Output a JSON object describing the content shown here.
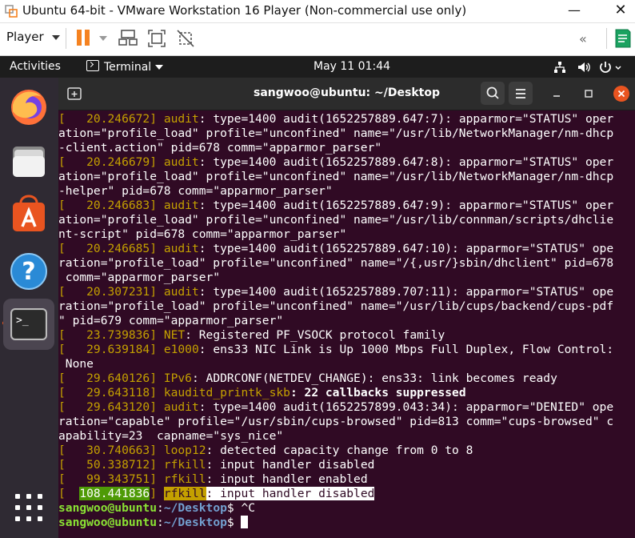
{
  "vmware": {
    "title": "Ubuntu 64-bit - VMware Workstation 16 Player (Non-commercial use only)",
    "player_menu": "Player",
    "minimize_symbol": "—",
    "close_symbol": "✕",
    "collapse_symbol": "«",
    "brand_color": "#f58220"
  },
  "ubuntu_topbar": {
    "activities": "Activities",
    "app_menu": "Terminal",
    "clock": "May 11  01:44"
  },
  "dock": {
    "items": [
      {
        "name": "Firefox",
        "icon": "firefox-icon"
      },
      {
        "name": "Files",
        "icon": "files-icon"
      },
      {
        "name": "Ubuntu Software",
        "icon": "software-store-icon"
      },
      {
        "name": "Help",
        "icon": "help-icon"
      },
      {
        "name": "Terminal",
        "icon": "terminal-icon",
        "active": true
      }
    ],
    "show_apps_icon": "apps-grid-icon"
  },
  "terminal": {
    "title": "sangwoo@ubuntu: ~/Desktop",
    "colors": {
      "background": "#300a24",
      "timestamp": "#c4a000",
      "user": "#8ae234",
      "path": "#729fcf",
      "close": "#e95420"
    },
    "lines": [
      {
        "pre": "[  ",
        "ts": " 20.246672",
        "post": "] ",
        "tag": "audit",
        "msg": ": type=1400 audit(1652257889.647:7): apparmor=\"STATUS\" oper"
      },
      {
        "plain": "ation=\"profile_load\" profile=\"unconfined\" name=\"/usr/lib/NetworkManager/nm-dhcp"
      },
      {
        "plain": "-client.action\" pid=678 comm=\"apparmor_parser\""
      },
      {
        "pre": "[  ",
        "ts": " 20.246679",
        "post": "] ",
        "tag": "audit",
        "msg": ": type=1400 audit(1652257889.647:8): apparmor=\"STATUS\" oper"
      },
      {
        "plain": "ation=\"profile_load\" profile=\"unconfined\" name=\"/usr/lib/NetworkManager/nm-dhcp"
      },
      {
        "plain": "-helper\" pid=678 comm=\"apparmor_parser\""
      },
      {
        "pre": "[  ",
        "ts": " 20.246683",
        "post": "] ",
        "tag": "audit",
        "msg": ": type=1400 audit(1652257889.647:9): apparmor=\"STATUS\" oper"
      },
      {
        "plain": "ation=\"profile_load\" profile=\"unconfined\" name=\"/usr/lib/connman/scripts/dhclie"
      },
      {
        "plain": "nt-script\" pid=678 comm=\"apparmor_parser\""
      },
      {
        "pre": "[  ",
        "ts": " 20.246685",
        "post": "] ",
        "tag": "audit",
        "msg": ": type=1400 audit(1652257889.647:10): apparmor=\"STATUS\" ope"
      },
      {
        "plain": "ration=\"profile_load\" profile=\"unconfined\" name=\"/{,usr/}sbin/dhclient\" pid=678"
      },
      {
        "plain": " comm=\"apparmor_parser\""
      },
      {
        "pre": "[  ",
        "ts": " 20.307231",
        "post": "] ",
        "tag": "audit",
        "msg": ": type=1400 audit(1652257889.707:11): apparmor=\"STATUS\" ope"
      },
      {
        "plain": "ration=\"profile_load\" profile=\"unconfined\" name=\"/usr/lib/cups/backend/cups-pdf"
      },
      {
        "plain": "\" pid=679 comm=\"apparmor_parser\""
      },
      {
        "pre": "[  ",
        "ts": " 23.739836",
        "post": "] ",
        "tag": "NET",
        "msg": ": Registered PF_VSOCK protocol family"
      },
      {
        "pre": "[  ",
        "ts": " 29.639184",
        "post": "] ",
        "tag": "e1000",
        "msg": ": ens33 NIC Link is Up 1000 Mbps Full Duplex, Flow Control:"
      },
      {
        "plain": " None"
      },
      {
        "pre": "[  ",
        "ts": " 29.640126",
        "post": "] ",
        "tag": "IPv6",
        "msg": ": ADDRCONF(NETDEV_CHANGE): ens33: link becomes ready"
      },
      {
        "pre": "[  ",
        "ts": " 29.643118",
        "post": "] ",
        "tag": "kauditd_printk_skb",
        "msg": ": 22 callbacks suppressed",
        "bold": true
      },
      {
        "pre": "[  ",
        "ts": " 29.643120",
        "post": "] ",
        "tag": "audit",
        "msg": ": type=1400 audit(1652257899.043:34): apparmor=\"DENIED\" ope"
      },
      {
        "plain": "ration=\"capable\" profile=\"/usr/sbin/cups-browsed\" pid=813 comm=\"cups-browsed\" c"
      },
      {
        "plain": "apability=23  capname=\"sys_nice\""
      },
      {
        "pre": "[  ",
        "ts": " 30.740663",
        "post": "] ",
        "tag": "loop12",
        "msg": ": detected capacity change from 0 to 8"
      },
      {
        "pre": "[  ",
        "ts": " 50.338712",
        "post": "] ",
        "tag": "rfkill",
        "msg": ": input handler disabled"
      },
      {
        "pre": "[  ",
        "ts": " 99.343751",
        "post": "] ",
        "tag": "rfkill",
        "msg": ": input handler enabled"
      },
      {
        "pre": "[  ",
        "ts": "108.441836",
        "post": "] ",
        "tag": "rfkill",
        "msg": ": input handler disabled",
        "highlight": true
      }
    ],
    "prompts": [
      {
        "user": "sangwoo@ubuntu",
        "sep": ":",
        "path": "~/Desktop",
        "sym": "$ ",
        "cmd": "^C"
      },
      {
        "user": "sangwoo@ubuntu",
        "sep": ":",
        "path": "~/Desktop",
        "sym": "$ ",
        "cmd": "",
        "cursor": true
      }
    ]
  }
}
